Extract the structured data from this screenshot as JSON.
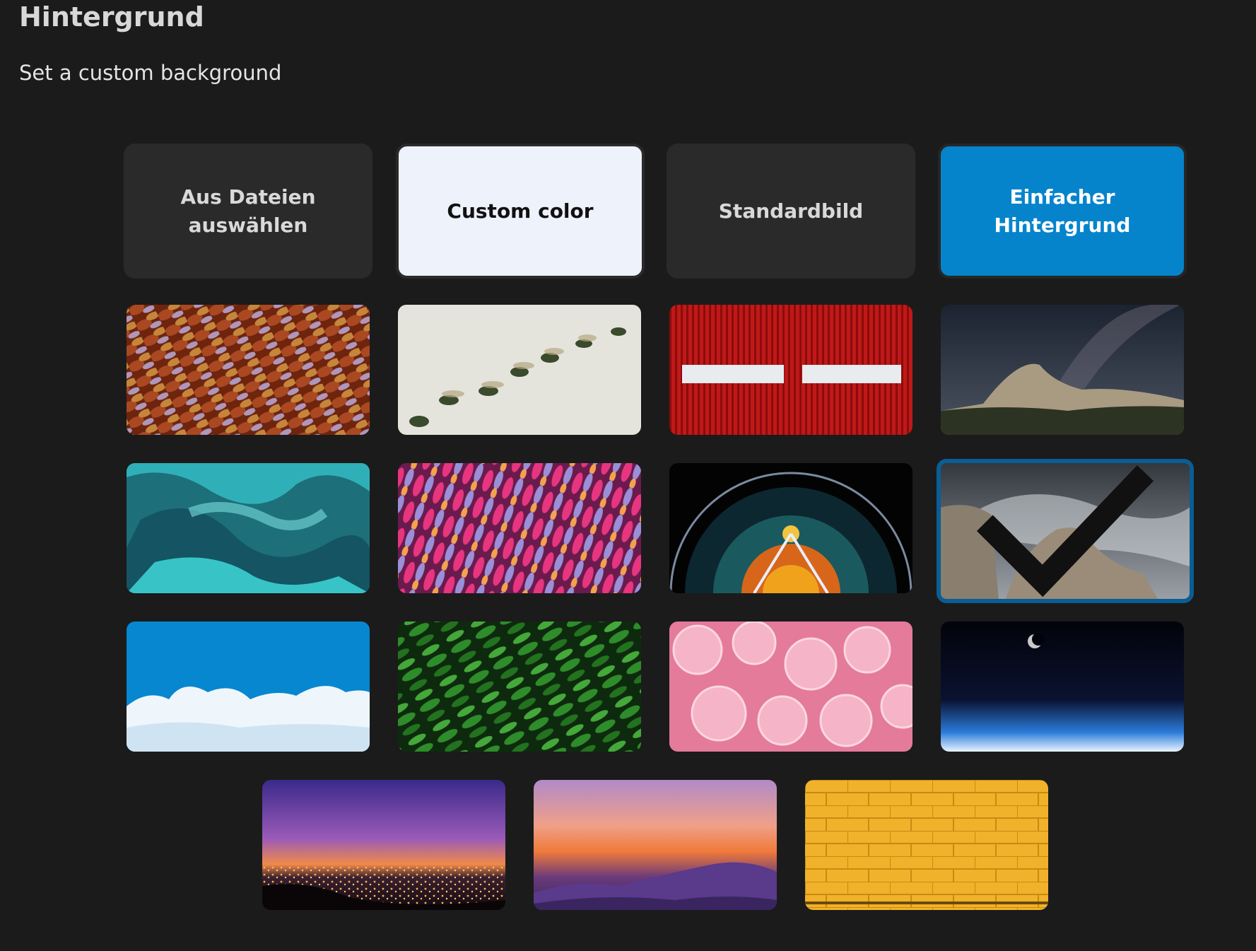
{
  "header": {
    "title": "Hintergrund",
    "subtitle": "Set a custom background"
  },
  "options": [
    {
      "label": "Aus Dateien\nauswählen",
      "style": "dark"
    },
    {
      "label": "Custom color",
      "style": "light"
    },
    {
      "label": "Standardbild",
      "style": "dark"
    },
    {
      "label": "Einfacher\nHintergrund",
      "style": "blue"
    }
  ],
  "colors": {
    "background": "#1b1b1b",
    "option_dark": "#2a2a2a",
    "option_light": "#edf2fb",
    "accent_blue": "#0584cc",
    "selected_border": "#0a5d95"
  },
  "backgrounds": [
    {
      "name": "butterfly-wing-scales"
    },
    {
      "name": "flying-beetles"
    },
    {
      "name": "red-corrugated-wall"
    },
    {
      "name": "milky-way-mountain"
    },
    {
      "name": "teal-fluid-art"
    },
    {
      "name": "pink-ribbon-pattern"
    },
    {
      "name": "ferris-wheel-night"
    },
    {
      "name": "stormy-sea-rocks",
      "selected": true
    },
    {
      "name": "blue-sky-clouds"
    },
    {
      "name": "green-fern-leaves"
    },
    {
      "name": "pink-bubbles"
    },
    {
      "name": "earth-from-space"
    },
    {
      "name": "city-night-skyline"
    },
    {
      "name": "sunset-mountains"
    },
    {
      "name": "yellow-brick-wall"
    }
  ],
  "icons": {
    "selected": "checkmark-icon"
  }
}
